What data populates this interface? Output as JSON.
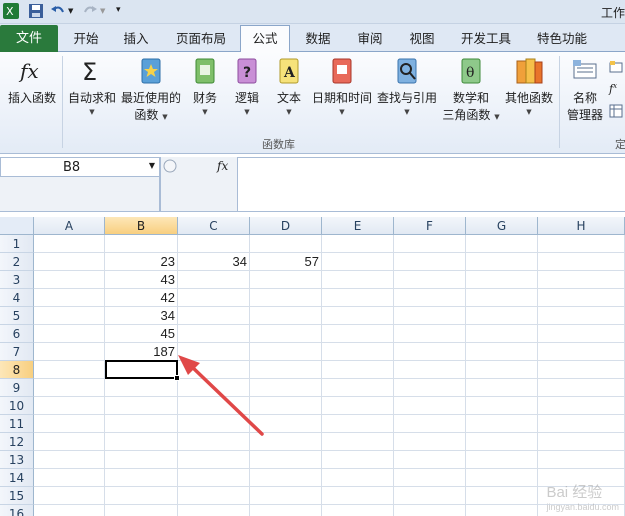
{
  "window": {
    "title": "工作"
  },
  "tabs": {
    "file": "文件",
    "items": [
      "开始",
      "插入",
      "页面布局",
      "公式",
      "数据",
      "审阅",
      "视图",
      "开发工具",
      "特色功能"
    ],
    "active": "公式"
  },
  "ribbon": {
    "insert_function": "插入函数",
    "autosum": "自动求和",
    "recent_line1": "最近使用的",
    "recent_line2": "函数",
    "financial": "财务",
    "logical": "逻辑",
    "text": "文本",
    "datetime": "日期和时间",
    "lookup": "查找与引用",
    "math_line1": "数学和",
    "math_line2": "三角函数",
    "other": "其他函数",
    "name_mgr_line1": "名称",
    "name_mgr_line2": "管理器",
    "group_label": "函数库",
    "group_label_right": "定"
  },
  "formula_bar": {
    "name_box": "B8",
    "fx": "fx",
    "formula": ""
  },
  "columns": [
    "A",
    "B",
    "C",
    "D",
    "E",
    "F",
    "G",
    "H"
  ],
  "selected_column": "B",
  "rows": [
    "1",
    "2",
    "3",
    "4",
    "5",
    "6",
    "7",
    "8",
    "9",
    "10",
    "11",
    "12",
    "13",
    "14",
    "15",
    "16"
  ],
  "selected_row": "8",
  "cells": {
    "B2": "23",
    "C2": "34",
    "D2": "57",
    "B3": "43",
    "B4": "42",
    "B5": "34",
    "B6": "45",
    "B7": "187"
  },
  "watermark": "Bai 经验",
  "watermark_sub": "jingyan.baidu.com",
  "colors": {
    "file_tab": "#2a7a3c",
    "arrow": "#e04848",
    "selection": "#000000"
  }
}
